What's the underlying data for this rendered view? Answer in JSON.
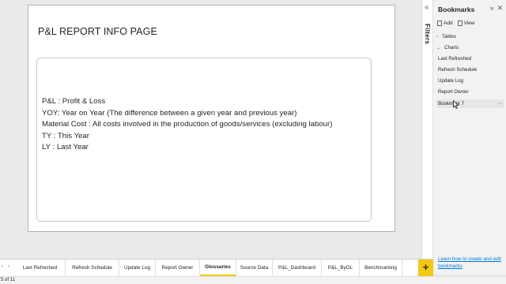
{
  "report": {
    "page_title": "P&L REPORT INFO PAGE",
    "glossary": [
      "P&L : Profit & Loss",
      "YOY: Year on Year (The difference between a given year and previous year)",
      "Material Cost : All costs involved in the production of goods/services (excluding labour)",
      "TY : This Year",
      "LY : Last Year"
    ]
  },
  "filters": {
    "label": "Filters",
    "collapse_icon": "chevron-double-left-icon"
  },
  "bookmarks": {
    "title": "Bookmarks",
    "header_icons": [
      "chevron-double-right-icon",
      "close-icon"
    ],
    "add_label": "Add",
    "view_label": "View",
    "groups": [
      {
        "label": "Tables",
        "expanded": false
      },
      {
        "label": "Charts",
        "expanded": true
      }
    ],
    "items": [
      {
        "label": "Last Refreshed"
      },
      {
        "label": "Refresh Schedule"
      },
      {
        "label": "Update Log"
      },
      {
        "label": "Report Owner"
      },
      {
        "label": "Bookmark 7",
        "selected": true,
        "more": "···"
      }
    ],
    "footer_link": "Learn how to create and edit bookmarks"
  },
  "tabs": {
    "items": [
      {
        "label": "Last Refreshed"
      },
      {
        "label": "Refresh Schedule"
      },
      {
        "label": "Update Log"
      },
      {
        "label": "Report Owner"
      },
      {
        "label": "Glossaries",
        "active": true
      },
      {
        "label": "Source Data"
      },
      {
        "label": "P&L_Dashboard"
      },
      {
        "label": "P&L_ByGL"
      },
      {
        "label": "Benchmarking"
      }
    ],
    "add_label": "+",
    "accent_color": "#f2c811"
  },
  "status": {
    "page_indicator": "5 of 11"
  }
}
